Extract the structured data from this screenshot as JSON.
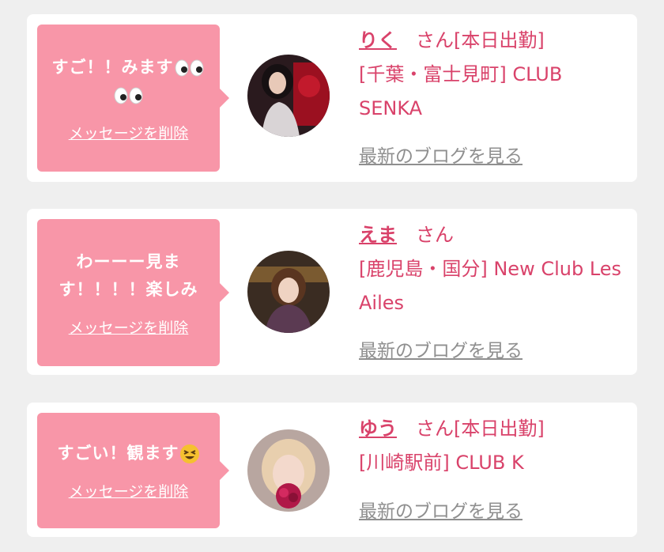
{
  "cards": [
    {
      "message": "すご！！みます",
      "delete_label": "メッセージを削除",
      "name": "りく",
      "suffix": "さん[本日出勤]",
      "shop": "[千葉・富士見町] CLUB SENKA",
      "blog_label": "最新のブログを見る",
      "emoji": "eyes-emoji"
    },
    {
      "message": "わーーー見ます！！！！楽しみ",
      "delete_label": "メッセージを削除",
      "name": "えま",
      "suffix": "さん",
      "shop": "[鹿児島・国分] New Club Les Ailes",
      "blog_label": "最新のブログを見る"
    },
    {
      "message": "すごい！観ます",
      "delete_label": "メッセージを削除",
      "name": "ゆう",
      "suffix": "さん[本日出勤]",
      "shop": "[川崎駅前] CLUB K",
      "blog_label": "最新のブログを見る",
      "emoji": "grinning-squinting-face-emoji"
    }
  ],
  "colors": {
    "bubble": "#f896a8",
    "accent": "#d9426a",
    "link_gray": "#8f8f8f",
    "background": "#efefef"
  }
}
